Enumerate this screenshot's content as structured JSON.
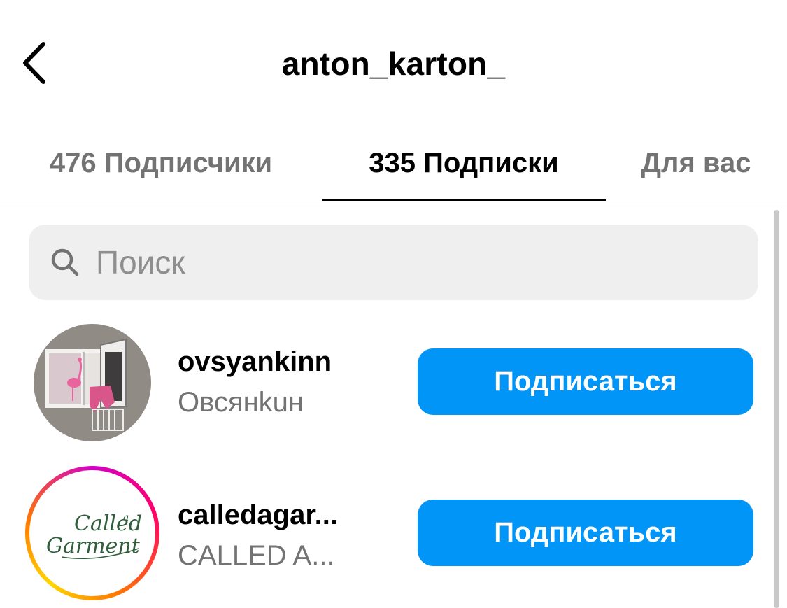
{
  "header": {
    "title": "anton_karton_",
    "back_icon": "chevron-left-icon"
  },
  "tabs": [
    {
      "label": "476 Подписчики",
      "active": false
    },
    {
      "label": "335 Подписки",
      "active": true
    },
    {
      "label": "Для вас",
      "active": false
    }
  ],
  "search": {
    "placeholder": "Поиск",
    "value": "",
    "icon": "search-icon"
  },
  "accounts": [
    {
      "username": "ovsyankinn",
      "full_name": "Овсянkuн",
      "button_label": "Подписаться",
      "has_story_ring": false
    },
    {
      "username": "calledagar...",
      "full_name": "CALLED A...",
      "button_label": "Подписаться",
      "has_story_ring": true,
      "avatar_text": [
        "Called",
        "a",
        "Garment"
      ]
    }
  ],
  "colors": {
    "accent": "#0095f6",
    "muted_text": "#737373",
    "search_bg": "#efefef",
    "logo_green": "#2f5e3a"
  }
}
